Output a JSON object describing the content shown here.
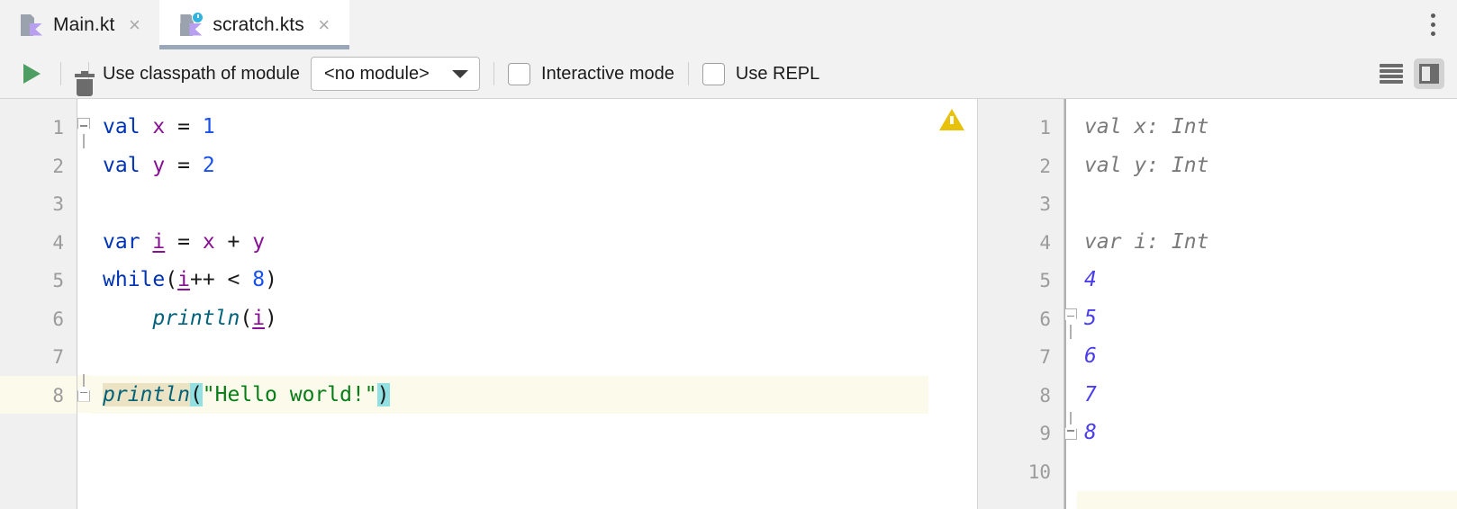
{
  "window": {
    "kebab_menu_label": "More options"
  },
  "tabs": [
    {
      "label": "Main.kt",
      "icon": "kotlin-file-icon",
      "active": false,
      "close_label": "×"
    },
    {
      "label": "scratch.kts",
      "icon": "kotlin-scratch-file-icon",
      "active": true,
      "close_label": "×"
    }
  ],
  "toolbar": {
    "run_icon": "run-triangle-icon",
    "delete_icon": "trash-icon",
    "classpath_label": "Use classpath of module",
    "module_value": "<no module>",
    "module_caret_icon": "chevron-down-icon",
    "interactive_mode_label": "Interactive mode",
    "interactive_mode_checked": false,
    "use_repl_label": "Use REPL",
    "use_repl_checked": false,
    "lines_icon": "list-lines-icon",
    "panel_icon": "toggle-side-panel-icon"
  },
  "editor": {
    "line_numbers": [
      "1",
      "2",
      "3",
      "4",
      "5",
      "6",
      "7",
      "8"
    ],
    "caret_line": 8,
    "warning_icon": "warning-triangle-icon",
    "lines": [
      {
        "n": 1,
        "tokens": [
          {
            "t": "val",
            "c": "kw"
          },
          {
            "t": " ",
            "c": "punc"
          },
          {
            "t": "x",
            "c": "prop"
          },
          {
            "t": " = ",
            "c": "punc"
          },
          {
            "t": "1",
            "c": "num"
          }
        ]
      },
      {
        "n": 2,
        "tokens": [
          {
            "t": "val",
            "c": "kw"
          },
          {
            "t": " ",
            "c": "punc"
          },
          {
            "t": "y",
            "c": "prop"
          },
          {
            "t": " = ",
            "c": "punc"
          },
          {
            "t": "2",
            "c": "num"
          }
        ]
      },
      {
        "n": 3,
        "tokens": []
      },
      {
        "n": 4,
        "tokens": [
          {
            "t": "var",
            "c": "kw"
          },
          {
            "t": " ",
            "c": "punc"
          },
          {
            "t": "i",
            "c": "prop-u"
          },
          {
            "t": " = ",
            "c": "punc"
          },
          {
            "t": "x",
            "c": "prop"
          },
          {
            "t": " + ",
            "c": "punc"
          },
          {
            "t": "y",
            "c": "prop"
          }
        ]
      },
      {
        "n": 5,
        "tokens": [
          {
            "t": "while",
            "c": "kw"
          },
          {
            "t": "(",
            "c": "punc"
          },
          {
            "t": "i",
            "c": "prop-u"
          },
          {
            "t": "++ < ",
            "c": "punc"
          },
          {
            "t": "8",
            "c": "num"
          },
          {
            "t": ")",
            "c": "punc"
          }
        ]
      },
      {
        "n": 6,
        "tokens": [
          {
            "t": "    ",
            "c": "punc"
          },
          {
            "t": "println",
            "c": "fn"
          },
          {
            "t": "(",
            "c": "punc"
          },
          {
            "t": "i",
            "c": "prop-u"
          },
          {
            "t": ")",
            "c": "punc"
          }
        ]
      },
      {
        "n": 7,
        "tokens": []
      },
      {
        "n": 8,
        "tokens": [
          {
            "t": "println",
            "c": "fn hl-ident"
          },
          {
            "t": "(",
            "c": "punc hl-brace"
          },
          {
            "t": "\"Hello world!\"",
            "c": "str"
          },
          {
            "t": ")",
            "c": "punc hl-brace"
          }
        ]
      }
    ]
  },
  "results": {
    "line_numbers": [
      "1",
      "2",
      "3",
      "4",
      "5",
      "6",
      "7",
      "8",
      "9",
      "10"
    ],
    "lines": [
      {
        "n": 1,
        "text": "val x: Int",
        "kind": "res-type"
      },
      {
        "n": 2,
        "text": "val y: Int",
        "kind": "res-type"
      },
      {
        "n": 3,
        "text": "",
        "kind": "res-type"
      },
      {
        "n": 4,
        "text": "var i: Int",
        "kind": "res-type"
      },
      {
        "n": 5,
        "text": "4",
        "kind": "res-val"
      },
      {
        "n": 6,
        "text": "5",
        "kind": "res-val"
      },
      {
        "n": 7,
        "text": "6",
        "kind": "res-val"
      },
      {
        "n": 8,
        "text": "7",
        "kind": "res-val"
      },
      {
        "n": 9,
        "text": "8",
        "kind": "res-val"
      },
      {
        "n": 10,
        "text": "",
        "kind": "res-val"
      }
    ]
  },
  "colors": {
    "keyword": "#0033b3",
    "number": "#1750eb",
    "property": "#871094",
    "function": "#00627a",
    "string": "#067d17",
    "result_value": "#4a3df0",
    "result_type": "#7a7a7a",
    "warning": "#e8c20a",
    "caret_row": "#fcfaeb",
    "identifier_highlight": "#ece3c4",
    "brace_highlight": "#93e0e3",
    "active_tab_underline": "#9aa7b8",
    "run_green": "#4e9e63"
  }
}
